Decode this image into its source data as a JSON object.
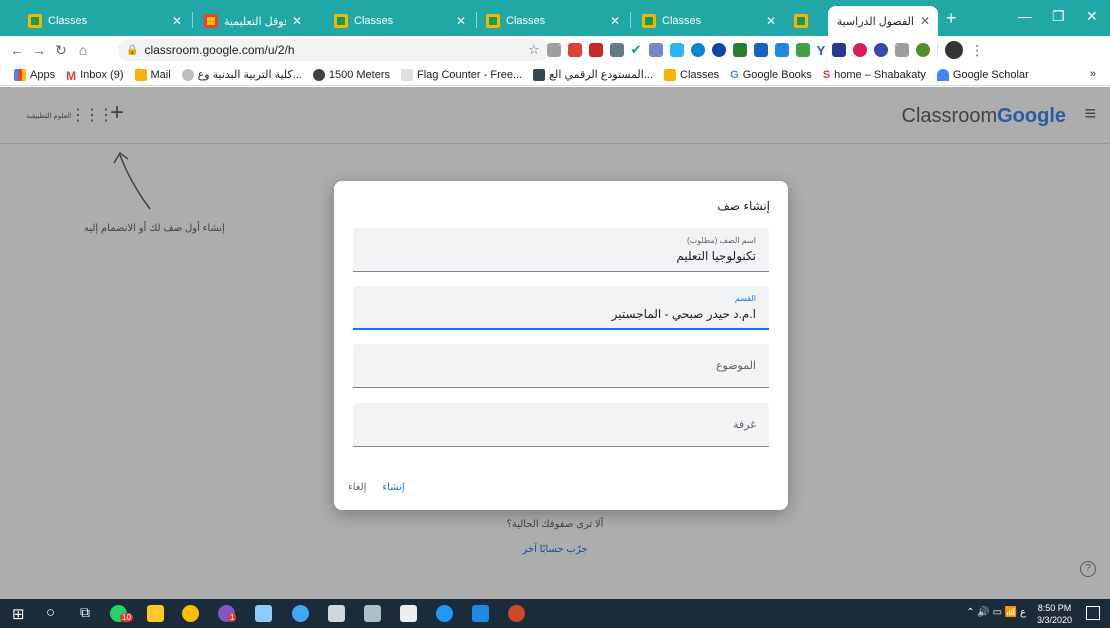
{
  "browser": {
    "tabs": [
      {
        "title": "Classes",
        "favicon": "classroom-icon"
      },
      {
        "title": "صفوف فوقل التعليمية -",
        "favicon": "google-drive-icon"
      },
      {
        "title": "Classes",
        "favicon": "classroom-icon"
      },
      {
        "title": "Classes",
        "favicon": "classroom-icon"
      },
      {
        "title": "Classes",
        "favicon": "classroom-icon"
      },
      {
        "title": "",
        "favicon": "classroom-icon"
      },
      {
        "title": "الفصول الدراسية",
        "favicon": "classroom-icon",
        "active": true
      }
    ],
    "new_tab": "+",
    "url": "classroom.google.com/u/2/h",
    "bookmarks": [
      {
        "label": "Apps",
        "icon": "apps-grid-icon"
      },
      {
        "label": "Inbox (9)",
        "icon": "gmail-icon"
      },
      {
        "label": "Mail",
        "icon": "mail-icon"
      },
      {
        "label": "كلية التربية البدنية وع...",
        "icon": "college-icon"
      },
      {
        "label": "1500 Meters",
        "icon": "link-icon"
      },
      {
        "label": "Flag Counter - Free...",
        "icon": "flag-counter-icon"
      },
      {
        "label": "المستودع الرقمي الع...",
        "icon": "repository-icon"
      },
      {
        "label": "Classes",
        "icon": "classroom-icon"
      },
      {
        "label": "Google Books",
        "icon": "google-icon"
      },
      {
        "label": "home – Shabakaty",
        "icon": "shabakaty-icon"
      },
      {
        "label": "Google Scholar",
        "icon": "scholar-icon"
      }
    ],
    "bookmarks_more": "»"
  },
  "page": {
    "logo_left": "Classroom",
    "logo_right": "Google",
    "header_small": "العلوم التطبيقية",
    "hint": "إنشاء أول صف لك أو الانضمام إليه",
    "bottom_question": "ألا ترى صفوفك الحالية؟",
    "bottom_link": "جرّب حسابًا آخر",
    "help": "?"
  },
  "dialog": {
    "title": "إنشاء صف",
    "fields": [
      {
        "label": "اسم الصف (مطلوب)",
        "value": "تكنولوجيا التعليم"
      },
      {
        "label": "القسم",
        "value": "ا.م.د حيدر صبحي - الماجستير"
      },
      {
        "placeholder": "الموضوع"
      },
      {
        "placeholder": "غرفة"
      }
    ],
    "create": "إنشاء",
    "cancel": "إلغاء"
  },
  "taskbar": {
    "clock_time": "8:50 PM",
    "clock_date": "3/3/2020",
    "tray_lang": "ع",
    "badges": [
      "10",
      "1"
    ]
  }
}
